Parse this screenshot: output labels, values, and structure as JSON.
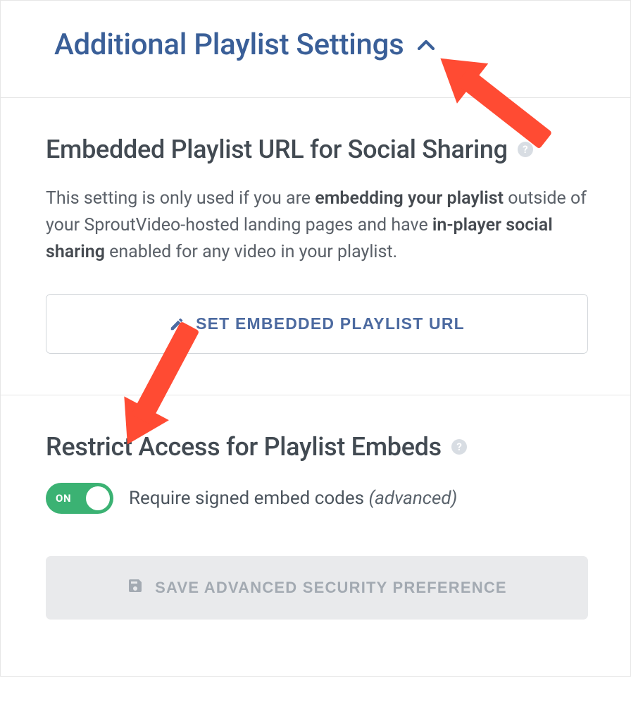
{
  "header": {
    "title": "Additional Playlist Settings"
  },
  "embedded_url": {
    "title": "Embedded Playlist URL for Social Sharing",
    "desc_prefix": "This setting is only used if you are ",
    "desc_bold1": "embedding your playlist",
    "desc_mid": " outside of your SproutVideo-hosted landing pages and have ",
    "desc_bold2": "in-player social sharing",
    "desc_suffix": " enabled for any video in your playlist.",
    "button_label": "SET EMBEDDED PLAYLIST URL"
  },
  "restrict": {
    "title": "Restrict Access for Playlist Embeds",
    "toggle_state_label": "ON",
    "toggle_description_prefix": "Require signed embed codes ",
    "toggle_description_italic": "(advanced)",
    "save_button_label": "SAVE ADVANCED SECURITY PREFERENCE"
  }
}
